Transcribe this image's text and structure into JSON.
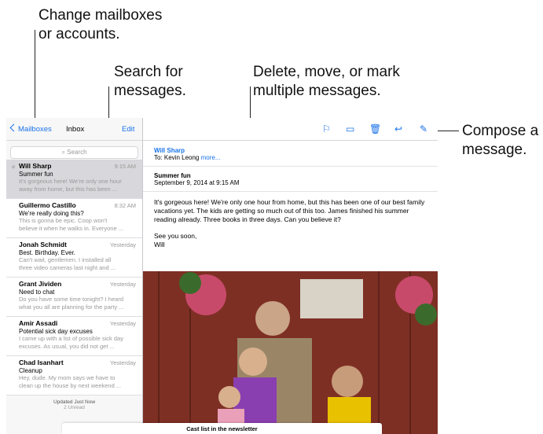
{
  "callouts": {
    "mailboxes": "Change mailboxes\nor accounts.",
    "mailboxes_l1": "Change mailboxes",
    "mailboxes_l2": "or accounts.",
    "search_l1": "Search for",
    "search_l2": "messages.",
    "delete_l1": "Delete, move, or mark",
    "delete_l2": "multiple messages.",
    "compose_l1": "Compose a",
    "compose_l2": "message."
  },
  "list": {
    "back_label": "Mailboxes",
    "title": "Inbox",
    "edit_label": "Edit",
    "search_placeholder": "Search",
    "messages": [
      {
        "from": "Will Sharp",
        "time": "9:15 AM",
        "subject": "Summer fun",
        "preview1": "It's gorgeous here! We're only one hour",
        "preview2": "away from home, but this has been ..."
      },
      {
        "from": "Guillermo Castillo",
        "time": "8:32 AM",
        "subject": "We're really doing this?",
        "preview1": "This is gonna be epic. Coop won't",
        "preview2": "believe it when he walks in. Everyone ..."
      },
      {
        "from": "Jonah Schmidt",
        "time": "Yesterday",
        "subject": "Best. Birthday. Ever.",
        "preview1": "Can't wait, gentlemen. I installed all",
        "preview2": "three video cameras last night and ..."
      },
      {
        "from": "Grant Jividen",
        "time": "Yesterday",
        "subject": "Need to chat",
        "preview1": "Do you have some time tonight? I heard",
        "preview2": "what you all are planning for the party ..."
      },
      {
        "from": "Amir Assadi",
        "time": "Yesterday",
        "subject": "Potential sick day excuses",
        "preview1": "I came up with a list of possible sick day",
        "preview2": "excuses. As usual, you did not get ..."
      },
      {
        "from": "Chad Isanhart",
        "time": "Yesterday",
        "subject": "Cleanup",
        "preview1": "Hey, dude. My mom says we have to",
        "preview2": "clean up the house by next weekend ..."
      }
    ],
    "status": "Updated Just Now",
    "status_sub": "2 Unread"
  },
  "detail": {
    "sender": "Will Sharp",
    "to_label": "To: Kevin Leong",
    "more": "more...",
    "subject": "Summer fun",
    "date": "September 9, 2014 at 9:15 AM",
    "body1": "It's gorgeous here! We're only one hour from home, but this has been one of our best family vacations yet. The kids are getting so much out of this too. James finished his summer reading already. Three books in three days. Can you believe it?",
    "body2": "See you soon,",
    "body3": "Will",
    "icons": [
      "flag-icon",
      "folder-icon",
      "trash-icon",
      "reply-icon",
      "compose-icon"
    ]
  },
  "draft": {
    "title": "Cast list in the newsletter"
  }
}
